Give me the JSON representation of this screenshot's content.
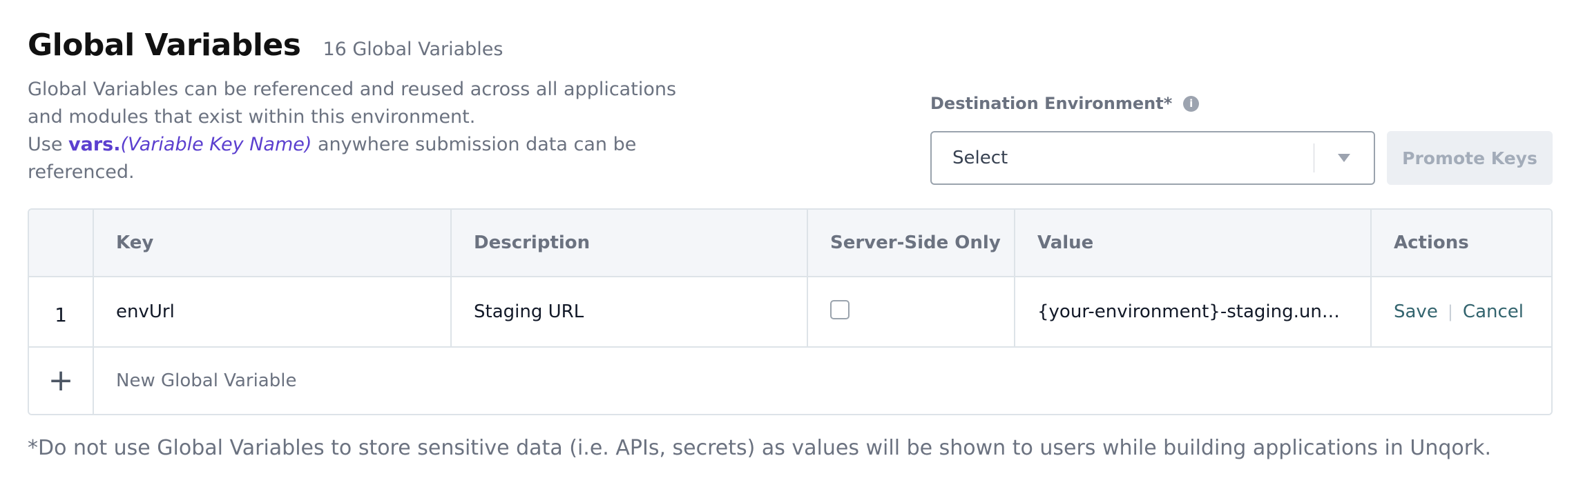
{
  "header": {
    "title": "Global Variables",
    "count_label": "16 Global Variables"
  },
  "description": {
    "line1": "Global Variables can be referenced and reused across all applications and modules that exist within this environment.",
    "use_prefix": "Use ",
    "vars_prefix": "vars.",
    "var_key_placeholder": "(Variable Key Name)",
    "use_suffix": " anywhere submission data can be referenced."
  },
  "destination": {
    "label": "Destination Environment*",
    "select_value": "Select",
    "info_icon": "info-icon",
    "caret_icon": "chevron-down-icon"
  },
  "promote_button": {
    "label": "Promote Keys"
  },
  "table": {
    "columns": [
      "",
      "Key",
      "Description",
      "Server-Side Only",
      "Value",
      "Actions"
    ],
    "rows": [
      {
        "number": "1",
        "key": "envUrl",
        "description": "Staging URL",
        "server_side_only": false,
        "value": "{your-environment}-staging.unqork.io",
        "actions": {
          "save": "Save",
          "cancel": "Cancel"
        }
      }
    ],
    "new_row": {
      "plus_icon": "+",
      "label": "New Global Variable"
    }
  },
  "footnote": "*Do not use Global Variables to store sensitive data (i.e. APIs, secrets) as values will be shown to users while building applications in Unqork.",
  "colors": {
    "accent": "#5b3fcf",
    "link": "#33646e",
    "muted_text": "#6b7280",
    "border": "#dde3e8",
    "header_bg": "#f4f6f9",
    "disabled_button_bg": "#eceff3"
  }
}
